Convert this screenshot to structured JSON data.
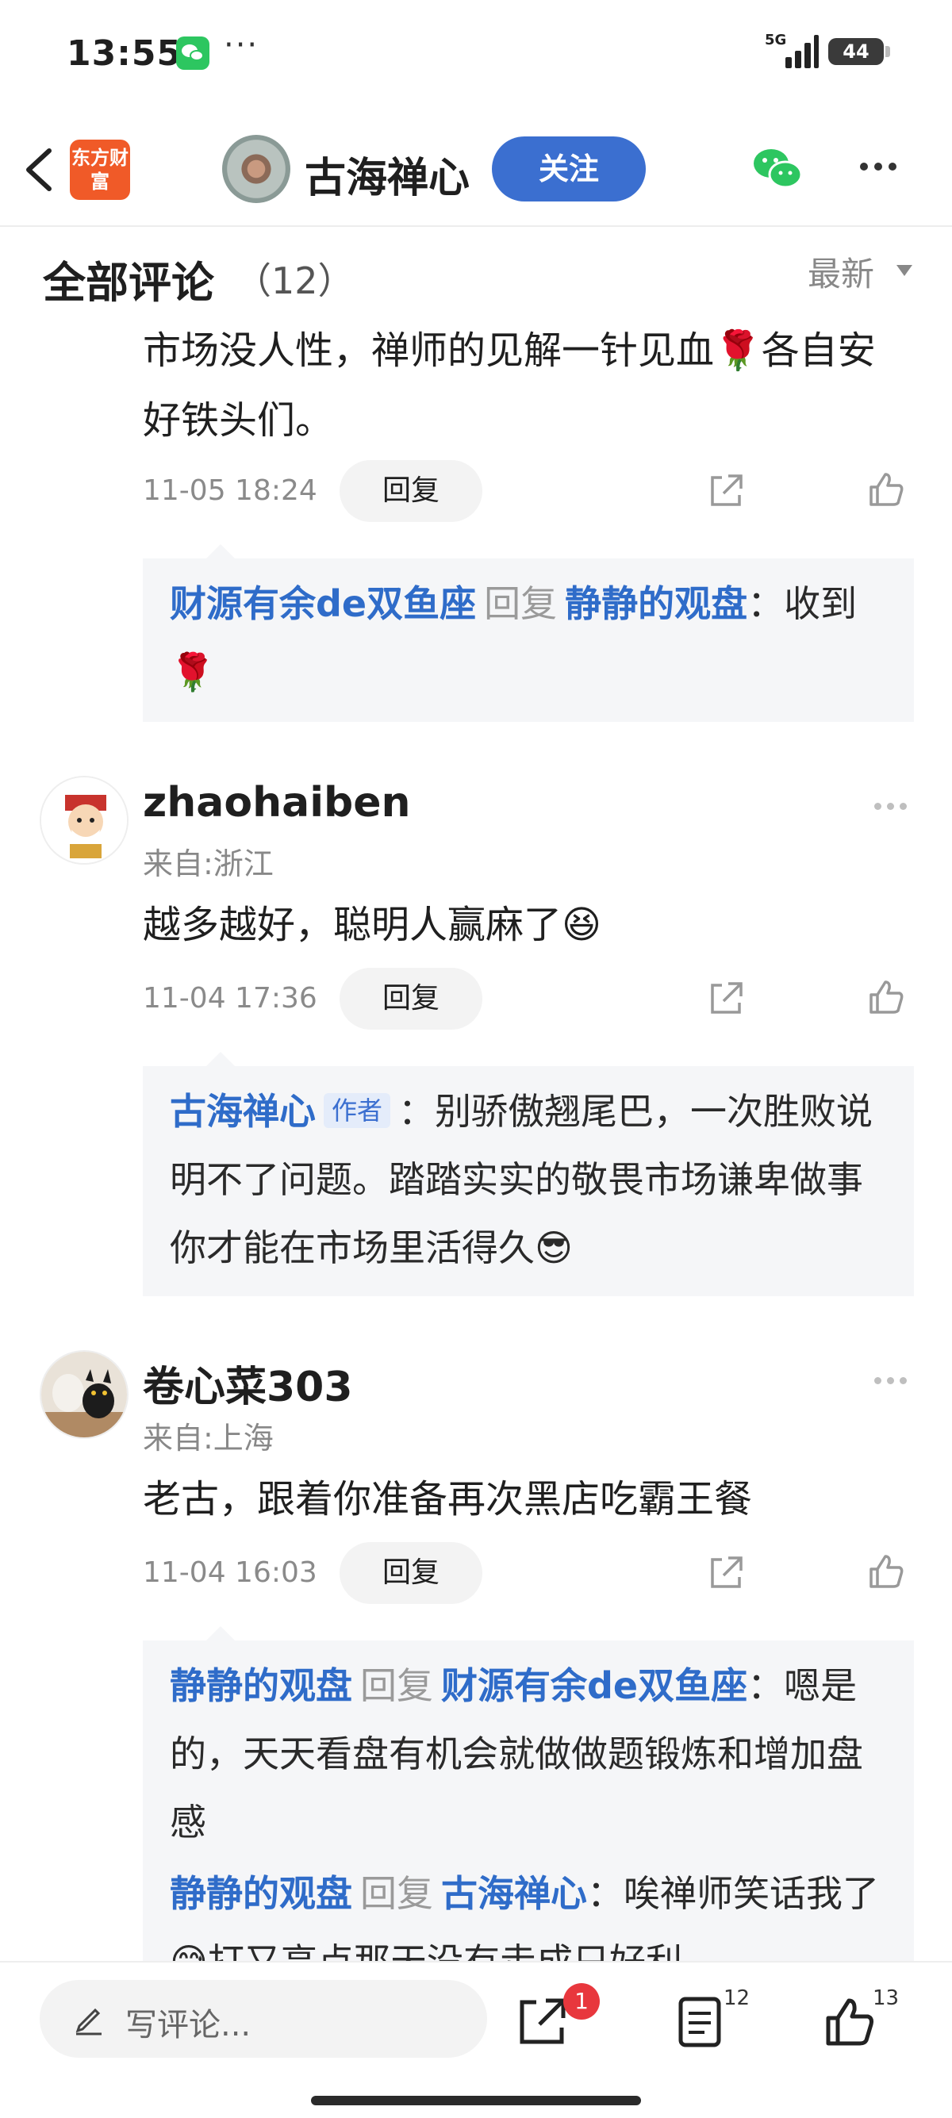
{
  "status_bar": {
    "time": "13:55",
    "more": "···",
    "network": "5G",
    "battery": "44"
  },
  "nav": {
    "brand_logo_text": "东方财富",
    "author_name": "古海禅心",
    "follow_label": "关注"
  },
  "section": {
    "title": "全部评论",
    "count": "（12）",
    "sort_label": "最新"
  },
  "comments": [
    {
      "text": "市场没人性，禅师的见解一针见血🌹各自安好铁头们。",
      "time": "11-05 18:24",
      "reply_label": "回复",
      "replies": [
        {
          "from": "财源有余de双鱼座",
          "verb": "回复",
          "to": "静静的观盘",
          "text": "：收到🌹"
        }
      ]
    },
    {
      "name": "zhaohaiben",
      "location": "来自:浙江",
      "text": "越多越好，聪明人赢麻了😆",
      "time": "11-04 17:36",
      "reply_label": "回复",
      "replies": [
        {
          "from": "古海禅心",
          "badge": "作者",
          "text": "：别骄傲翘尾巴，一次胜败说明不了问题。踏踏实实的敬畏市场谦卑做事你才能在市场里活得久😎"
        }
      ]
    },
    {
      "name": "卷心菜303",
      "location": "来自:上海",
      "text": "老古，跟着你准备再次黑店吃霸王餐",
      "time": "11-04 16:03",
      "reply_label": "回复",
      "replies": [
        {
          "from": "静静的观盘",
          "verb": "回复",
          "to": "财源有余de双鱼座",
          "text": "：嗯是的，天天看盘有机会就做做题锻炼和增加盘感"
        },
        {
          "from": "静静的观盘",
          "verb": "回复",
          "to": "古海禅心",
          "text": "：唉禅师笑话我了😅打又高点那天没有走成只好利"
        }
      ]
    }
  ],
  "bottom_bar": {
    "comment_placeholder": "写评论...",
    "share_badge": "1",
    "comment_count": "12",
    "like_count": "13"
  },
  "colors": {
    "accent": "#3b6fd0",
    "link": "#2f6cc9",
    "badge_red": "#e8373d",
    "brand_orange": "#f05a28"
  }
}
